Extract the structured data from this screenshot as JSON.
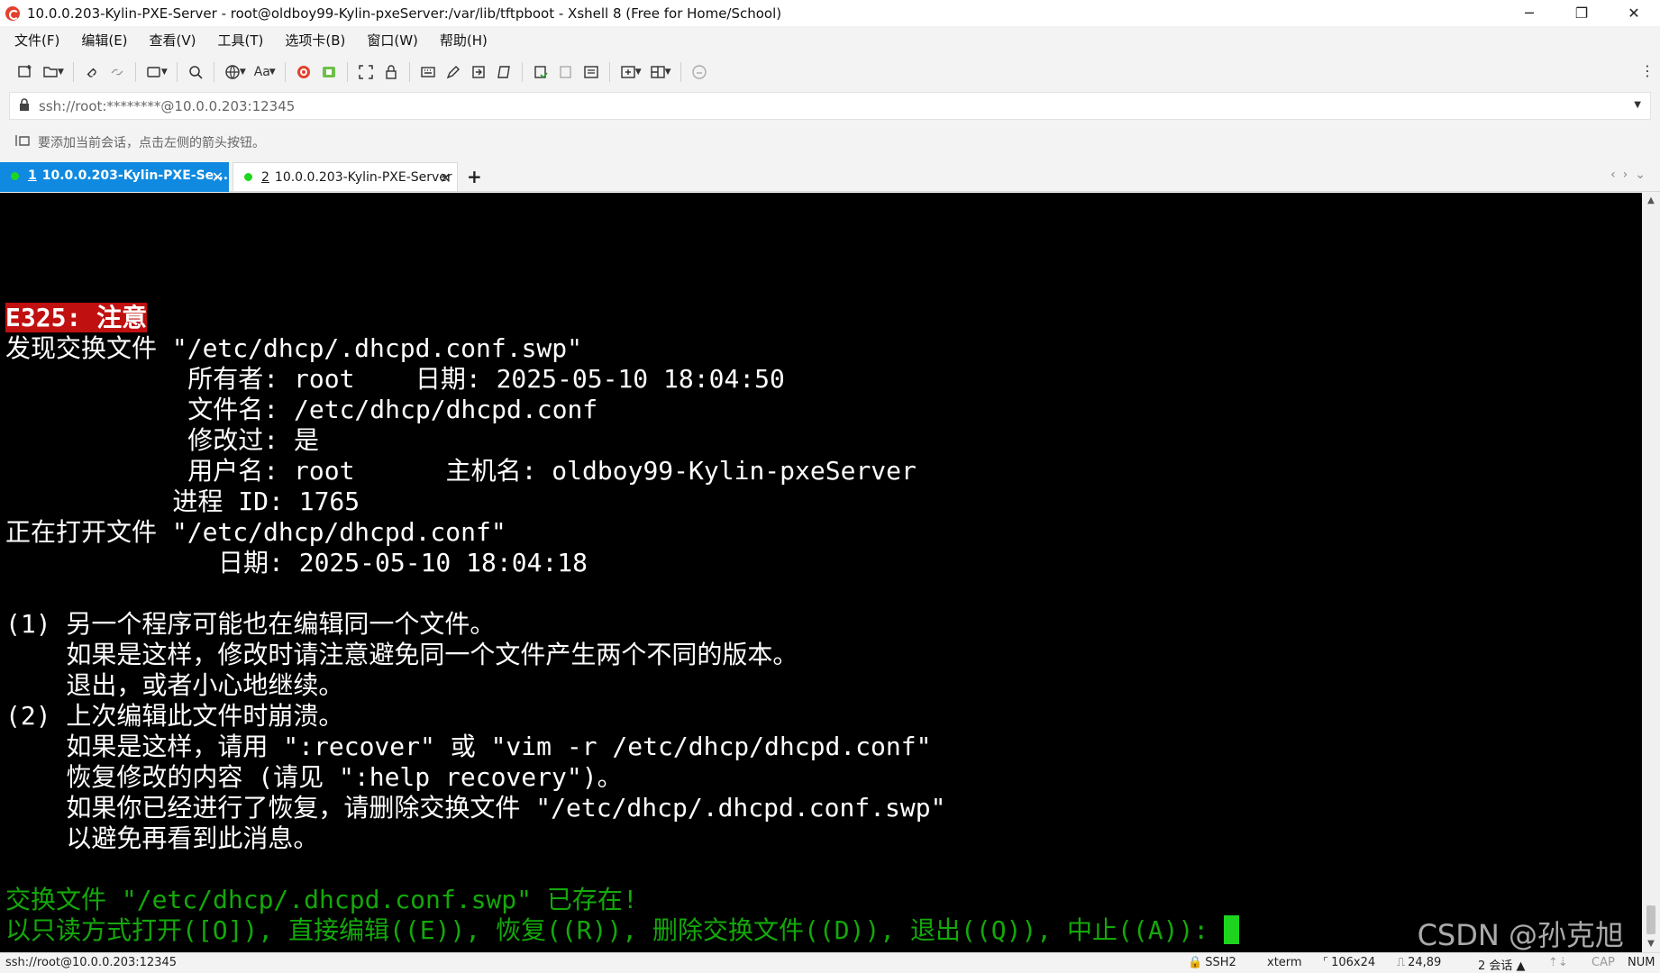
{
  "window": {
    "title": "10.0.0.203-Kylin-PXE-Server - root@oldboy99-Kylin-pxeServer:/var/lib/tftpboot - Xshell 8 (Free for Home/School)",
    "minimize": "─",
    "restore": "❐",
    "close": "✕"
  },
  "menu": {
    "items": [
      "文件(F)",
      "编辑(E)",
      "查看(V)",
      "工具(T)",
      "选项卡(B)",
      "窗口(W)",
      "帮助(H)"
    ]
  },
  "toolbar": {
    "font_label": "Aa",
    "more": "⋮"
  },
  "address": {
    "value": "ssh://root:********@10.0.0.203:12345",
    "dropdown": "▼"
  },
  "hint": {
    "text": "要添加当前会话，点击左侧的箭头按钮。"
  },
  "tabs": [
    {
      "num": "1",
      "title": "10.0.0.203-Kylin-PXE-Se...",
      "close": "✕"
    },
    {
      "num": "2",
      "title": "10.0.0.203-Kylin-PXE-Server",
      "close": "✕"
    }
  ],
  "tab_add": "+",
  "tab_nav": "‹›⌄",
  "terminal": {
    "warning": "E325: 注意",
    "lines": [
      "发现交换文件 \"/etc/dhcp/.dhcpd.conf.swp\"",
      "            所有者: root    日期: 2025-05-10 18:04:50",
      "            文件名: /etc/dhcp/dhcpd.conf",
      "            修改过: 是",
      "            用户名: root      主机名: oldboy99-Kylin-pxeServer",
      "           进程 ID: 1765",
      "正在打开文件 \"/etc/dhcp/dhcpd.conf\"",
      "              日期: 2025-05-10 18:04:18",
      "",
      "(1) 另一个程序可能也在编辑同一个文件。",
      "    如果是这样，修改时请注意避免同一个文件产生两个不同的版本。",
      "    退出，或者小心地继续。",
      "(2) 上次编辑此文件时崩溃。",
      "    如果是这样，请用 \":recover\" 或 \"vim -r /etc/dhcp/dhcpd.conf\"",
      "    恢复修改的内容 (请见 \":help recovery\")。",
      "    如果你已经进行了恢复，请删除交换文件 \"/etc/dhcp/.dhcpd.conf.swp\"",
      "    以避免再看到此消息。"
    ],
    "prompt_exists": "交换文件 \"/etc/dhcp/.dhcpd.conf.swp\" 已存在!",
    "prompt_choice": "以只读方式打开([O]), 直接编辑((E)), 恢复((R)), 删除交换文件((D)), 退出((Q)), 中止((A)): "
  },
  "watermark": "CSDN @孙克旭",
  "status": {
    "path": "ssh://root@10.0.0.203:12345",
    "protocol": "SSH2",
    "term": "xterm",
    "size": "106x24",
    "cursor_pos": "24,89",
    "sessions": "2 会话",
    "cap": "CAP",
    "num": "NUM"
  },
  "colors": {
    "tab_active": "#0f8ae0",
    "terminal_bg": "#000000",
    "warning_bg": "#c01010",
    "prompt_green": "#14a80a",
    "cursor": "#1ed41e"
  }
}
